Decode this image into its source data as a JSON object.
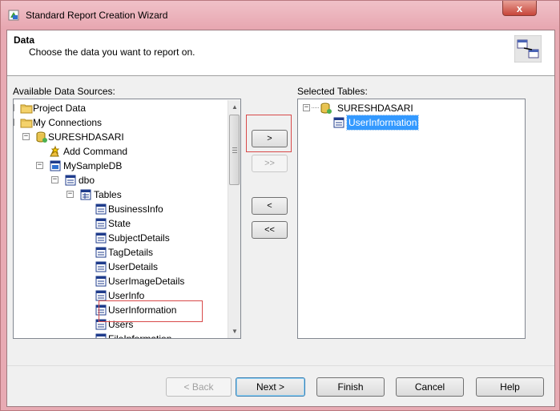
{
  "window": {
    "title": "Standard Report Creation Wizard",
    "close_label": "x"
  },
  "header": {
    "title": "Data",
    "subtitle": "Choose the data you want to report on."
  },
  "available": {
    "label": "Available Data Sources:",
    "items": [
      {
        "label": "Project Data",
        "icon": "folder-icon",
        "expander": "+"
      },
      {
        "label": "My Connections",
        "icon": "folder-icon",
        "expander": "−"
      },
      {
        "label": "SURESHDASARI",
        "icon": "database-server-icon",
        "expander": "−"
      },
      {
        "label": "Add Command",
        "icon": "add-command-icon",
        "expander": ""
      },
      {
        "label": "MySampleDB",
        "icon": "database-icon",
        "expander": "−"
      },
      {
        "label": "dbo",
        "icon": "schema-icon",
        "expander": "−"
      },
      {
        "label": "Tables",
        "icon": "tables-icon",
        "expander": "−"
      },
      {
        "label": "BusinessInfo",
        "icon": "table-icon",
        "expander": ""
      },
      {
        "label": "State",
        "icon": "table-icon",
        "expander": ""
      },
      {
        "label": "SubjectDetails",
        "icon": "table-icon",
        "expander": ""
      },
      {
        "label": "TagDetails",
        "icon": "table-icon",
        "expander": ""
      },
      {
        "label": "UserDetails",
        "icon": "table-icon",
        "expander": ""
      },
      {
        "label": "UserImageDetails",
        "icon": "table-icon",
        "expander": ""
      },
      {
        "label": "UserInfo",
        "icon": "table-icon",
        "expander": ""
      },
      {
        "label": "UserInformation",
        "icon": "table-icon",
        "expander": ""
      },
      {
        "label": "Users",
        "icon": "table-icon",
        "expander": ""
      },
      {
        "label": "FileInformation",
        "icon": "table-icon",
        "expander": ""
      }
    ]
  },
  "selected": {
    "label": "Selected Tables:",
    "server": "SURESHDASARI",
    "server_expander": "−",
    "table": "UserInformation"
  },
  "transfer": {
    "add": ">",
    "add_all": ">>",
    "remove": "<",
    "remove_all": "<<"
  },
  "footer": {
    "back": "< Back",
    "next": "Next >",
    "finish": "Finish",
    "cancel": "Cancel",
    "help": "Help"
  }
}
